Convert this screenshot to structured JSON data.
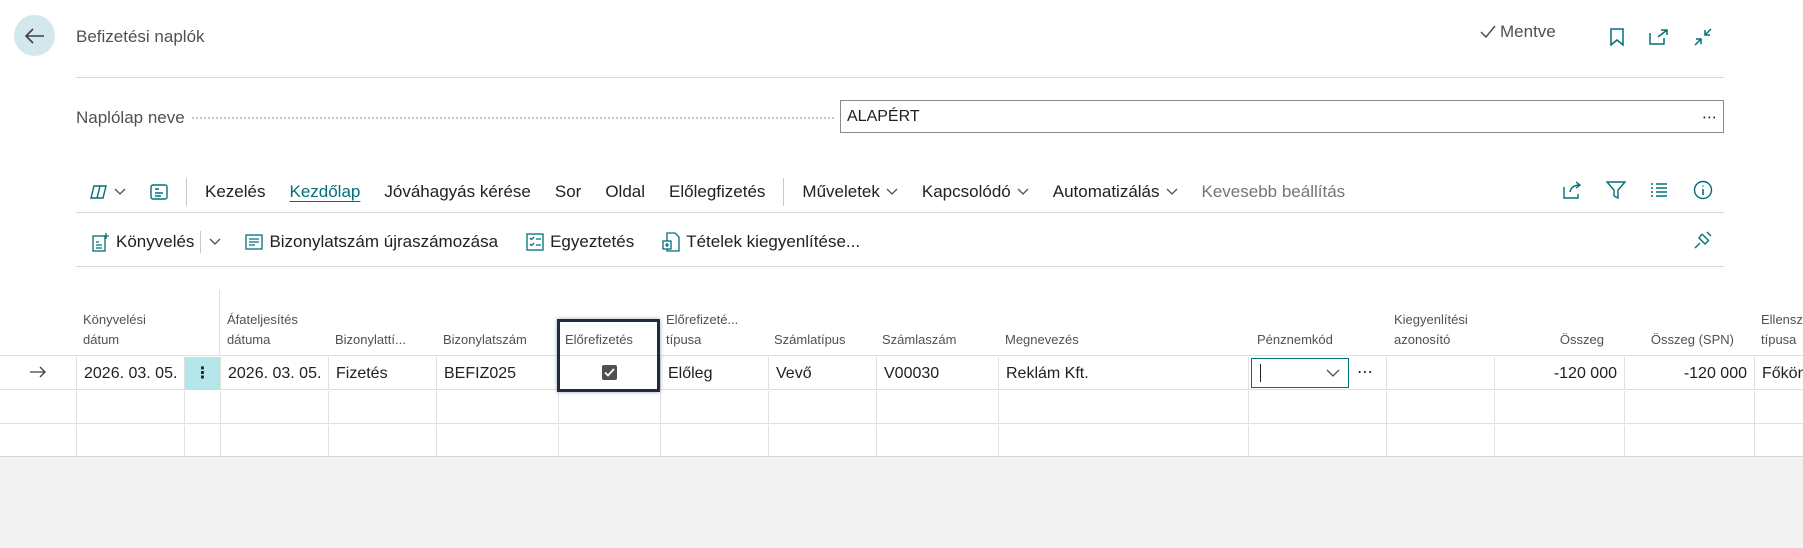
{
  "header": {
    "title": "Befizetési naplók",
    "saved_label": "Mentve"
  },
  "journal": {
    "label": "Naplólap neve",
    "value": "ALAPÉRT",
    "lookup": "⋯"
  },
  "actionbar": {
    "items": [
      "Kezelés",
      "Kezdőlap",
      "Jóváhagyás kérése",
      "Sor",
      "Oldal",
      "Előlegfizetés"
    ],
    "dropdowns": [
      "Műveletek",
      "Kapcsolódó",
      "Automatizálás"
    ],
    "less_options": "Kevesebb beállítás"
  },
  "subbar": {
    "posting": "Könyvelés",
    "renumber": "Bizonylatszám újraszámozása",
    "reconcile": "Egyeztetés",
    "apply": "Tételek kiegyenlítése..."
  },
  "columns": {
    "posting_date_1": "Könyvelési",
    "posting_date_2": "dátum",
    "vat_date_1": "Áfateljesítés",
    "vat_date_2": "dátuma",
    "doc_type": "Bizonylattí...",
    "doc_no": "Bizonylatszám",
    "prepayment": "Előrefizetés",
    "prepay_type_1": "Előrefizeté...",
    "prepay_type_2": "típusa",
    "account_type": "Számlatípus",
    "account_no": "Számlaszám",
    "description": "Megnevezés",
    "currency": "Pénznemkód",
    "applies_id_1": "Kiegyenlítési",
    "applies_id_2": "azonosító",
    "amount": "Összeg",
    "amount_lcy": "Összeg (SPN)",
    "bal_type_1": "Ellensz",
    "bal_type_2": "típusa"
  },
  "rows": [
    {
      "posting_date": "2026. 03. 05.",
      "vat_date": "2026. 03. 05.",
      "doc_type": "Fizetés",
      "doc_no": "BEFIZ025",
      "prepayment": true,
      "prepay_type": "Előleg",
      "account_type": "Vevő",
      "account_no": "V00030",
      "description": "Reklám Kft.",
      "currency": "",
      "applies_id": "",
      "amount": "-120 000",
      "amount_lcy": "-120 000",
      "bal_type": "Főkön"
    }
  ],
  "colors": {
    "accent": "#00707a",
    "back_bg": "#d3e8ec",
    "row_marker_bg": "#b5e6ea"
  }
}
